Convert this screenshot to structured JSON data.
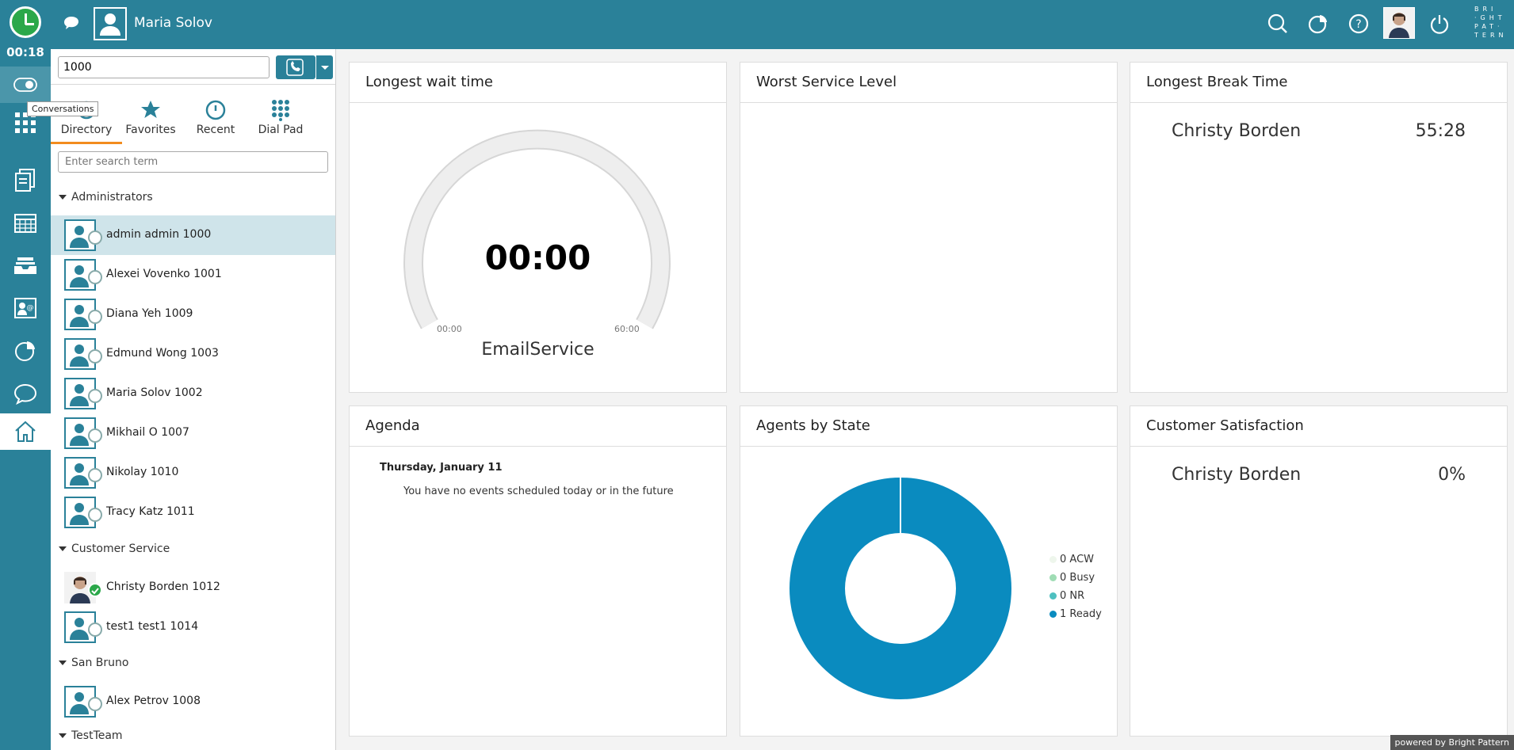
{
  "topbar": {
    "timer": "00:18",
    "user_name": "Maria Solov",
    "logo_lines": [
      "BRI",
      "·GHT",
      "PAT·",
      "TERN"
    ]
  },
  "rail": {
    "tooltip": "Conversations"
  },
  "directory": {
    "dial_value": "1000",
    "search_placeholder": "Enter search term",
    "tabs": [
      {
        "label": "Directory"
      },
      {
        "label": "Favorites"
      },
      {
        "label": "Recent"
      },
      {
        "label": "Dial Pad"
      }
    ],
    "groups": [
      {
        "name": "Administrators"
      },
      {
        "name": "Customer Service"
      },
      {
        "name": "San Bruno"
      },
      {
        "name": "TestTeam"
      }
    ],
    "contacts": [
      {
        "name": "admin admin 1000"
      },
      {
        "name": "Alexei Vovenko 1001"
      },
      {
        "name": "Diana Yeh 1009"
      },
      {
        "name": "Edmund Wong 1003"
      },
      {
        "name": "Maria Solov 1002"
      },
      {
        "name": "Mikhail O 1007"
      },
      {
        "name": "Nikolay 1010"
      },
      {
        "name": "Tracy Katz 1011"
      },
      {
        "name": "Christy Borden 1012"
      },
      {
        "name": "test1 test1 1014"
      },
      {
        "name": "Alex Petrov 1008"
      }
    ]
  },
  "widgets": {
    "wait": {
      "title": "Longest wait time",
      "value": "00:00",
      "min": "00:00",
      "max": "60:00",
      "service": "EmailService"
    },
    "service_level": {
      "title": "Worst Service Level"
    },
    "break": {
      "title": "Longest Break Time",
      "name": "Christy Borden",
      "value": "55:28"
    },
    "agenda": {
      "title": "Agenda",
      "date": "Thursday, January 11",
      "message": "You have no events scheduled today or in the future"
    },
    "agents": {
      "title": "Agents by State",
      "legend": [
        {
          "label": "0 ACW",
          "count": 0,
          "color": "#eef6ec"
        },
        {
          "label": "0 Busy",
          "count": 0,
          "color": "#9fdcb4"
        },
        {
          "label": "0 NR",
          "count": 0,
          "color": "#4ec0c0"
        },
        {
          "label": "1 Ready",
          "count": 1,
          "color": "#0a8bbf"
        }
      ]
    },
    "csat": {
      "title": "Customer Satisfaction",
      "name": "Christy Borden",
      "value": "0%"
    }
  },
  "footer": {
    "powered": "powered by Bright Pattern"
  }
}
